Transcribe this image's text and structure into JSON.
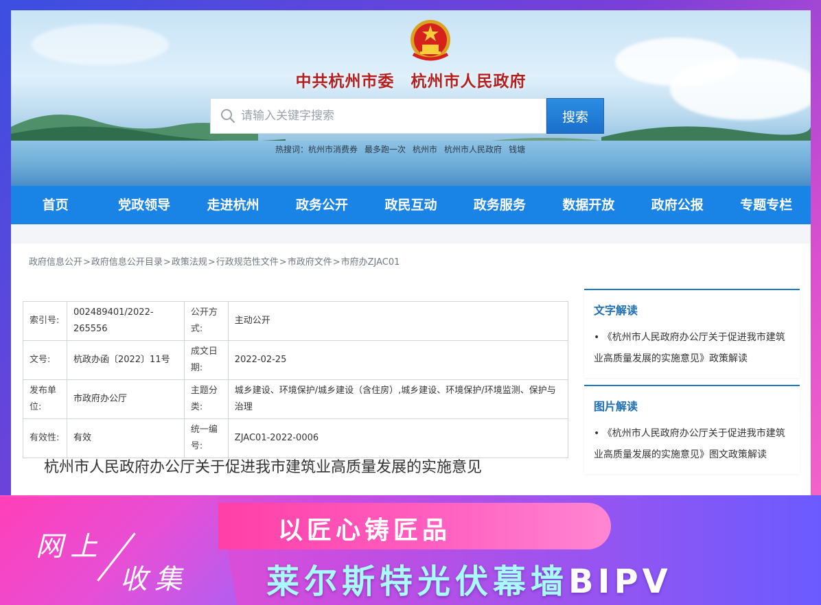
{
  "header": {
    "title": "中共杭州市委　杭州市人民政府",
    "search": {
      "placeholder": "请输入关键字搜索",
      "button_label": "搜索"
    },
    "hot_words": [
      "热搜词：杭州市消费券",
      "最多跑一次",
      "杭州市",
      "杭州市人民政府",
      "钱塘"
    ]
  },
  "nav": {
    "items": [
      "首页",
      "党政领导",
      "走进杭州",
      "政务公开",
      "政民互动",
      "政务服务",
      "数据开放",
      "政府公报",
      "专题专栏"
    ]
  },
  "breadcrumb": {
    "items": [
      "政府信息公开",
      "政府信息公开目录",
      "政策法规",
      "行政规范性文件",
      "市政府文件",
      "市府办ZJAC01"
    ],
    "separator": ">"
  },
  "meta_table": {
    "rows": [
      {
        "k1": "索引号:",
        "v1": "002489401/2022-265556",
        "k2": "公开方式:",
        "v2": "主动公开"
      },
      {
        "k1": "文号:",
        "v1": "杭政办函〔2022〕11号",
        "k2": "成文日期:",
        "v2": "2022-02-25"
      },
      {
        "k1": "发布单位:",
        "v1": "市政府办公厅",
        "k2": "主题分类:",
        "v2": "城乡建设、环境保护/城乡建设（含住房）,城乡建设、环境保护/环境监测、保护与治理"
      },
      {
        "k1": "有效性:",
        "v1": "有效",
        "k2": "统一编号:",
        "v2": "ZJAC01-2022-0006"
      }
    ]
  },
  "document": {
    "title": "杭州市人民政府办公厅关于促进我市建筑业高质量发展的实施意见"
  },
  "sidebar": {
    "text_reading": {
      "heading": "文字解读",
      "item": "• 《杭州市人民政府办公厅关于促进我市建筑业高质量发展的实施意见》政策解读"
    },
    "image_reading": {
      "heading": "图片解读",
      "item": "• 《杭州市人民政府办公厅关于促进我市建筑业高质量发展的实施意见》图文政策解读"
    }
  },
  "overlay": {
    "collect_line1": "网上",
    "collect_line2": "收集",
    "slogan": "以匠心铸匠品",
    "brand_cn": "莱尔斯特光伏幕墙",
    "brand_latin": "BIPV"
  },
  "colors": {
    "nav_blue": "#1a83e6",
    "title_red": "#b41f1f",
    "brand_cyan": "#a8fbff",
    "pink": "#ff3fb8"
  }
}
